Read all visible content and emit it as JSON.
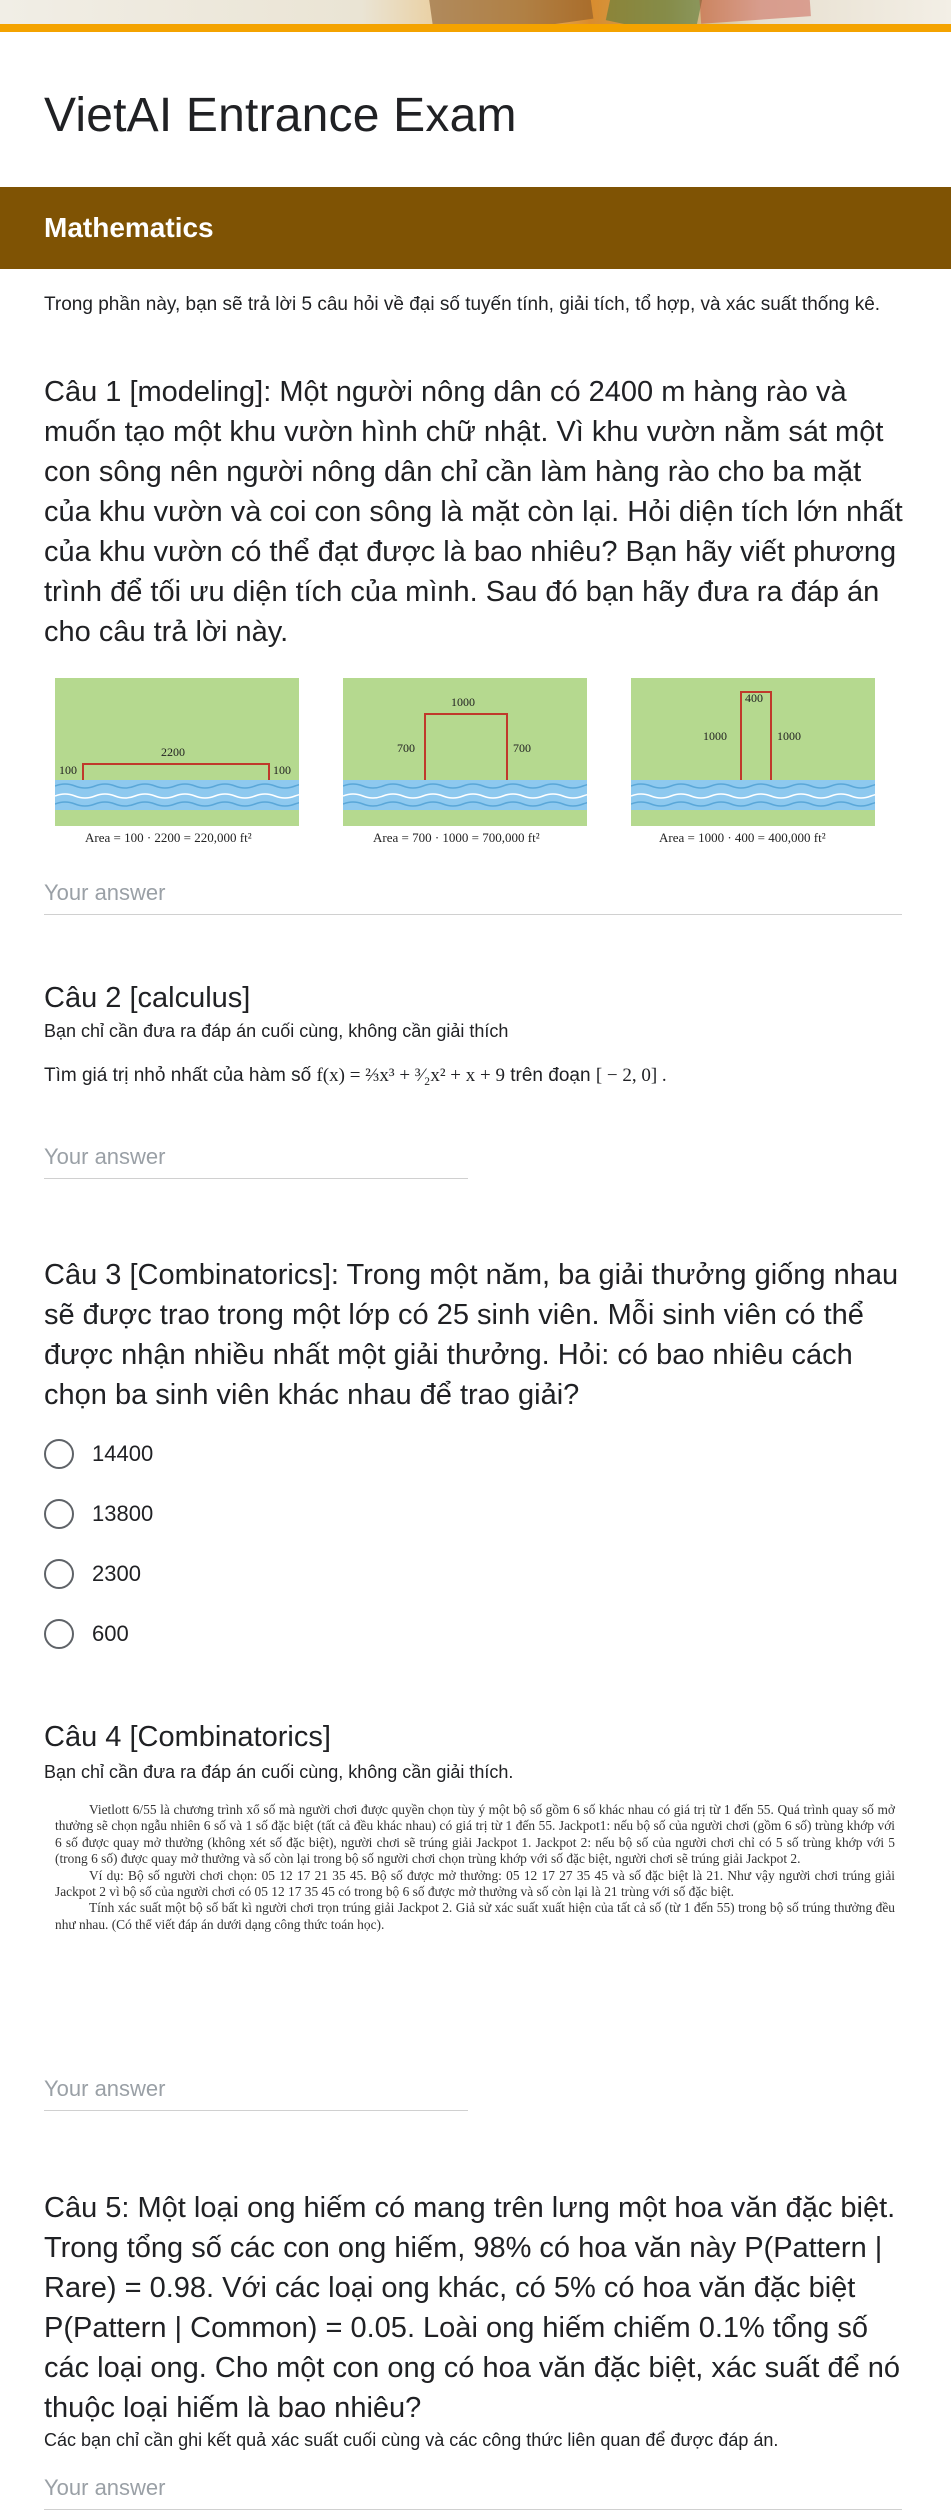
{
  "form": {
    "title": "VietAI Entrance Exam"
  },
  "section": {
    "title": "Mathematics",
    "description": "Trong phần này, bạn sẽ trả lời 5 câu hỏi về đại số tuyến tính, giải tích, tổ hợp, và xác suất thống kê."
  },
  "q1": {
    "title": "Câu 1 [modeling]: Một người nông dân có 2400 m hàng rào và muốn tạo một khu vườn hình chữ nhật. Vì khu vườn nằm sát một con sông nên người nông dân chỉ cần làm hàng rào cho ba mặt của khu vườn và coi con sông là mặt còn lại. Hỏi diện tích lớn nhất của khu vườn có thể đạt được là bao nhiêu? Bạn hãy viết phương trình để tối ưu diện tích của mình. Sau đó bạn hãy đưa ra đáp án cho câu trả lời này.",
    "placeholder": "Your answer",
    "figures": [
      {
        "top": "2200",
        "left": "100",
        "right": "100",
        "caption": "Area = 100 · 2200 = 220,000 ft²"
      },
      {
        "top": "1000",
        "left": "700",
        "right": "700",
        "caption": "Area = 700 · 1000 = 700,000 ft²"
      },
      {
        "top": "400",
        "left": "1000",
        "right": "1000",
        "caption": "Area = 1000 · 400 = 400,000 ft²"
      }
    ]
  },
  "q2": {
    "title": "Câu 2 [calculus]",
    "help": "Bạn chỉ cần đưa ra đáp án cuối cùng, không cần giải thích",
    "prompt_prefix": "Tìm giá trị nhỏ nhất của hàm số",
    "function": "f(x) = ⅔x³ + ³⁄₂x² + x + 9",
    "prompt_middle": "trên đoạn",
    "interval": "[ − 2, 0] .",
    "placeholder": "Your answer"
  },
  "q3": {
    "title": "Câu 3 [Combinatorics]: Trong một năm, ba giải thưởng giống nhau sẽ được trao trong một lớp có 25 sinh viên. Mỗi sinh viên có thể được nhận nhiều nhất một giải thưởng. Hỏi: có bao nhiêu cách chọn ba sinh viên khác nhau để trao giải?",
    "options": [
      "14400",
      "13800",
      "2300",
      "600"
    ]
  },
  "q4": {
    "title": "Câu 4 [Combinatorics]",
    "help": "Bạn chỉ cần đưa ra đáp án cuối cùng, không cần giải thích.",
    "paragraphs": [
      "Vietlott 6/55 là chương trình xổ số mà người chơi được quyền chọn tùy ý một bộ số gồm 6 số khác nhau có giá trị từ 1 đến 55. Quá trình quay số mở thưởng sẽ chọn ngẫu nhiên 6 số và 1 số đặc biệt (tất cả đều khác nhau) có giá trị từ 1 đến 55. Jackpot1: nếu bộ số của người chơi (gồm 6 số) trùng khớp với 6 số được quay mở thưởng (không xét số đặc biệt), người chơi sẽ trúng giải Jackpot 1. Jackpot 2: nếu bộ số của người chơi chỉ có 5 số trùng khớp với 5 (trong 6 số) được quay mở thưởng và số còn lại trong bộ số người chơi chọn trùng khớp với số đặc biệt, người chơi sẽ trúng giải Jackpot 2.",
      "Ví dụ: Bộ số người chơi chọn: 05 12 17 21 35 45. Bộ số được mở thưởng: 05 12 17 27 35 45 và số đặc biệt là 21. Như vậy người chơi trúng giải Jackpot 2 vì bộ số của người chơi có 05 12 17 35 45 có trong bộ 6 số được mở thưởng và số còn lại là 21 trùng với số đặc biệt.",
      "Tính xác suất một bộ số bất kì người chơi trọn trúng giải Jackpot 2. Giả sử xác suất xuất hiện của tất cả số (từ 1 đến 55) trong bộ số trúng thưởng đều như nhau. (Có thể viết đáp án dưới dạng công thức toán học)."
    ],
    "placeholder": "Your answer"
  },
  "q5": {
    "title": "Câu 5: Một loại ong hiếm có mang trên lưng một hoa văn đặc biệt. Trong tổng số các con ong hiếm, 98% có hoa văn này P(Pattern | Rare) = 0.98. Với các loại ong khác, có 5% có hoa văn đặc biệt P(Pattern | Common) = 0.05. Loài ong hiếm chiếm 0.1% tổng số các loại ong. Cho một con ong có hoa văn đặc biệt, xác suất để nó thuộc loại hiếm là bao nhiêu?",
    "help": "Các bạn chỉ cần ghi kết quả xác suất cuối cùng và các công thức liên quan để được đáp án.",
    "placeholder": "Your answer"
  },
  "colors": {
    "section_header": "#7f5304",
    "accent_bar": "#f4a300",
    "field_green": "#b5d98f",
    "fence": "#c0392b",
    "river": "#8ec9ef"
  }
}
